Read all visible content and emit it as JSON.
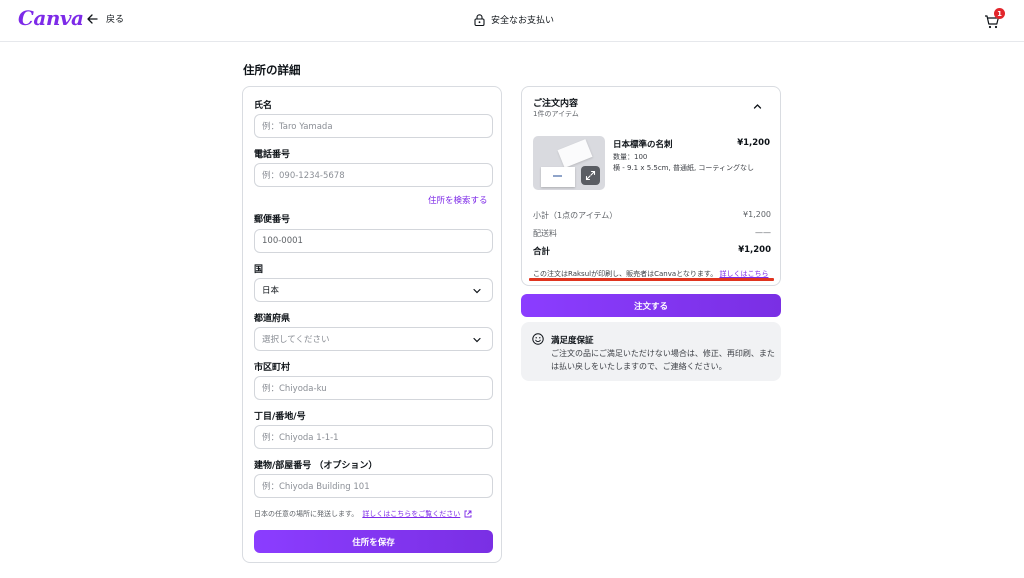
{
  "header": {
    "logo": "Canva",
    "back_label": "戻る",
    "secure_label": "安全なお支払い",
    "cart_count": "1"
  },
  "page_title": "住所の詳細",
  "form": {
    "name_label": "氏名",
    "name_placeholder": "例：Taro Yamada",
    "phone_label": "電話番号",
    "phone_placeholder": "例：090-1234-5678",
    "search_address_link": "住所を検索する",
    "postal_label": "郵便番号",
    "postal_placeholder": "100-0001",
    "country_label": "国",
    "country_value": "日本",
    "prefecture_label": "都道府県",
    "prefecture_placeholder": "選択してください",
    "city_label": "市区町村",
    "city_placeholder": "例：Chiyoda-ku",
    "street_label": "丁目/番地/号",
    "street_placeholder": "例：Chiyoda 1-1-1",
    "building_label": "建物/部屋番号 （オプション）",
    "building_placeholder": "例：Chiyoda Building 101",
    "shipping_note": "日本の任意の場所に発送します。",
    "shipping_note_link": "詳しくはこちらをご覧ください",
    "save_button": "住所を保存"
  },
  "order": {
    "title": "ご注文内容",
    "subtitle": "1件のアイテム",
    "item": {
      "name": "日本標準の名刺",
      "price": "¥1,200",
      "quantity": "数量：100",
      "spec": "横 - 9.1 x 5.5cm, 普通紙, コーティングなし"
    },
    "subtotal_label": "小計（1点のアイテム）",
    "subtotal_value": "¥1,200",
    "shipping_label": "配送料",
    "shipping_value": "——",
    "total_label": "合計",
    "total_value": "¥1,200",
    "disclaimer": "この注文はRaksulが印刷し、販売者はCanvaとなります。",
    "disclaimer_link": "詳しくはこちら",
    "order_button": "注文する"
  },
  "guarantee": {
    "title": "満足度保証",
    "body": "ご注文の品にご満足いただけない場合は、修正、再印刷、または払い戻しをいたしますので、ご連絡ください。"
  },
  "colors": {
    "brand": "#7d2ae8",
    "accent_button": "#8b3dff",
    "badge": "#e2262c",
    "highlight": "#e0341f"
  }
}
